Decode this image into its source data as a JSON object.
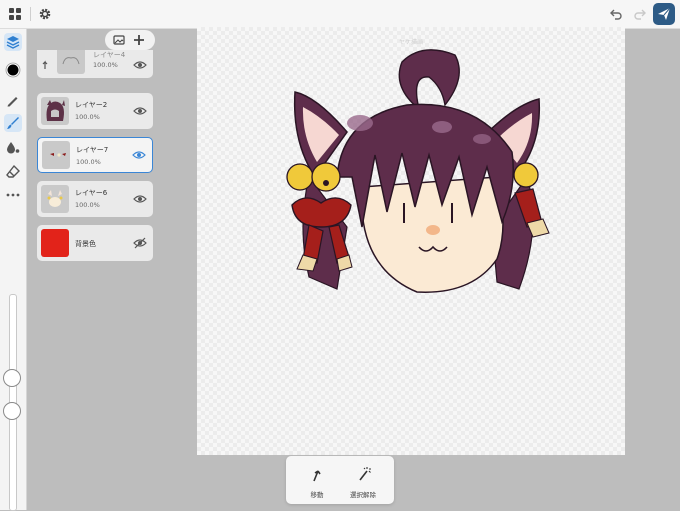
{
  "topbar": {
    "icons": [
      "grid-icon",
      "gear-icon",
      "undo-icon",
      "redo-icon",
      "send-icon"
    ]
  },
  "toolbar": {
    "tools": [
      "layers-icon",
      "color-icon",
      "pen-icon",
      "brush-icon",
      "fill-icon",
      "eraser-icon",
      "more-icon"
    ],
    "active_tool": "brush-icon",
    "current_color": "#000000"
  },
  "layers_panel": {
    "layers": [
      {
        "name": "レイヤー4",
        "opacity": "100.0%",
        "visible": true,
        "clipped": true
      },
      {
        "name": "レイヤー2",
        "opacity": "100.0%",
        "visible": true
      },
      {
        "name": "レイヤー7",
        "opacity": "100.0%",
        "visible": true,
        "selected": true
      },
      {
        "name": "レイヤー6",
        "opacity": "100.0%",
        "visible": true
      },
      {
        "name": "背景色",
        "visible": false,
        "color": "#e2231a"
      }
    ]
  },
  "canvas": {
    "hint": "ヤケ描画"
  },
  "bottom_popup": {
    "move_label": "移動",
    "deselect_label": "選択解除"
  },
  "colors": {
    "accent": "#3a86d6",
    "send_button": "#2d5b86",
    "background_layer": "#e2231a"
  }
}
